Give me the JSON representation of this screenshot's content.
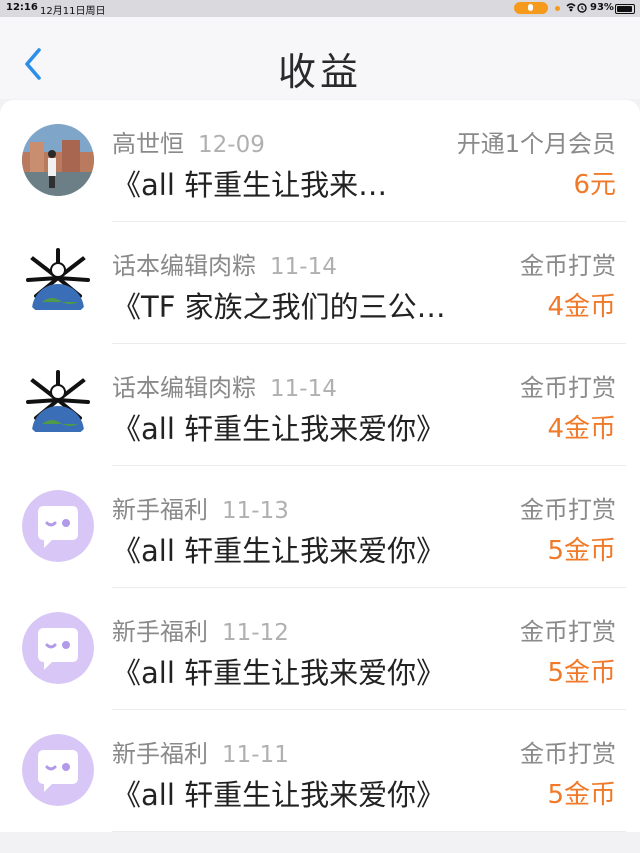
{
  "status_bar": {
    "time": "12:16",
    "date": "12月11日周日",
    "battery": "93%",
    "battery_level": 0.93,
    "icons": [
      "mic-icon",
      "wifi-icon",
      "alarm-icon",
      "battery-icon"
    ]
  },
  "header": {
    "title": "收益",
    "back_icon": "chevron-left-icon",
    "accent_color": "#2c8ee8"
  },
  "colors": {
    "amount": "#f07a2a",
    "meta": "#8a8a8a",
    "title": "#222222"
  },
  "records": [
    {
      "user": "高世恒",
      "date": "12-09",
      "type": "开通1个月会员",
      "title": "《all 轩重生让我来…",
      "amount": "6元",
      "avatar": "photo-avatar"
    },
    {
      "user": "话本编辑肉粽",
      "date": "11-14",
      "type": "金币打赏",
      "title": "《TF 家族之我们的三公…",
      "amount": "4金币",
      "avatar": "earth-avatar"
    },
    {
      "user": "话本编辑肉粽",
      "date": "11-14",
      "type": "金币打赏",
      "title": "《all 轩重生让我来爱你》",
      "amount": "4金币",
      "avatar": "earth-avatar"
    },
    {
      "user": "新手福利",
      "date": "11-13",
      "type": "金币打赏",
      "title": "《all 轩重生让我来爱你》",
      "amount": "5金币",
      "avatar": "chat-bubble-avatar"
    },
    {
      "user": "新手福利",
      "date": "11-12",
      "type": "金币打赏",
      "title": "《all 轩重生让我来爱你》",
      "amount": "5金币",
      "avatar": "chat-bubble-avatar"
    },
    {
      "user": "新手福利",
      "date": "11-11",
      "type": "金币打赏",
      "title": "《all 轩重生让我来爱你》",
      "amount": "5金币",
      "avatar": "chat-bubble-avatar"
    }
  ]
}
